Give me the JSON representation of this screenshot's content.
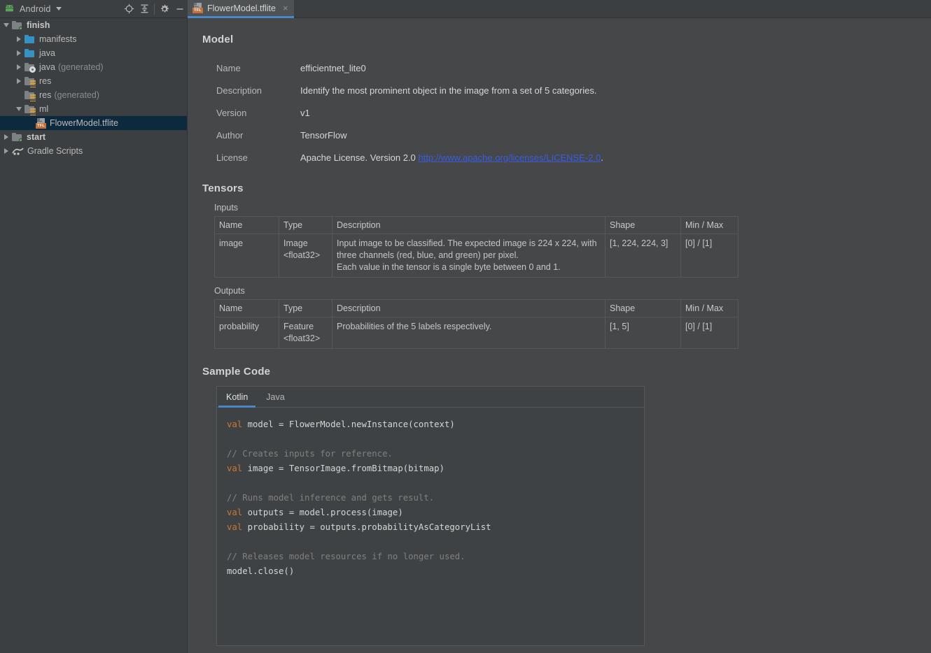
{
  "toolbar": {
    "app_label": "Android",
    "dropdown_icon": "caret-down-icon",
    "buttons": [
      {
        "name": "locate-icon",
        "title": "Select Opened File"
      },
      {
        "name": "collapse-all-icon",
        "title": "Collapse All"
      },
      {
        "name": "gear-icon",
        "title": "Settings"
      },
      {
        "name": "minimize-icon",
        "title": "Hide"
      }
    ]
  },
  "tab": {
    "title": "FlowerModel.tflite",
    "icon": "tfl-file-icon",
    "badge": "TFL",
    "close_glyph": "×",
    "accent": "#4a88c7"
  },
  "tree": [
    {
      "label": "finish",
      "suffix": "",
      "indent": 0,
      "twisty": "down",
      "icon": "module-folder-icon",
      "bold": true,
      "selected": false
    },
    {
      "label": "manifests",
      "suffix": "",
      "indent": 1,
      "twisty": "right",
      "icon": "folder-icon",
      "bold": false,
      "selected": false
    },
    {
      "label": "java",
      "suffix": "",
      "indent": 1,
      "twisty": "right",
      "icon": "folder-icon",
      "bold": false,
      "selected": false
    },
    {
      "label": "java",
      "suffix": " (generated)",
      "indent": 1,
      "twisty": "right",
      "icon": "generated-folder-icon",
      "bold": false,
      "selected": false
    },
    {
      "label": "res",
      "suffix": "",
      "indent": 1,
      "twisty": "right",
      "icon": "res-folder-icon",
      "bold": false,
      "selected": false
    },
    {
      "label": "res",
      "suffix": " (generated)",
      "indent": 1,
      "twisty": "none",
      "icon": "res-folder-icon",
      "bold": false,
      "selected": false
    },
    {
      "label": "ml",
      "suffix": "",
      "indent": 1,
      "twisty": "down",
      "icon": "res-folder-icon",
      "bold": false,
      "selected": false
    },
    {
      "label": "FlowerModel.tflite",
      "suffix": "",
      "indent": 2,
      "twisty": "none",
      "icon": "tfl-file-icon",
      "bold": false,
      "selected": true
    },
    {
      "label": "start",
      "suffix": "",
      "indent": 0,
      "twisty": "right",
      "icon": "module-folder-icon",
      "bold": true,
      "selected": false
    },
    {
      "label": "Gradle Scripts",
      "suffix": "",
      "indent": 0,
      "twisty": "right",
      "icon": "gradle-icon",
      "bold": false,
      "selected": false
    }
  ],
  "model": {
    "heading": "Model",
    "rows": [
      {
        "key": "Name",
        "value": "efficientnet_lite0"
      },
      {
        "key": "Description",
        "value": "Identify the most prominent object in the image from a set of 5 categories."
      },
      {
        "key": "Version",
        "value": "v1"
      },
      {
        "key": "Author",
        "value": "TensorFlow"
      }
    ],
    "license": {
      "key": "License",
      "prefix": "Apache License. Version 2.0 ",
      "link_text": "http://www.apache.org/licenses/LICENSE-2.0",
      "suffix": ".",
      "link_color": "#3b5ce0"
    }
  },
  "tensors": {
    "heading": "Tensors",
    "columns": [
      "Name",
      "Type",
      "Description",
      "Shape",
      "Min / Max"
    ],
    "inputs": {
      "label": "Inputs",
      "rows": [
        {
          "name": "image",
          "type": "Image\n<float32>",
          "description": "Input image to be classified. The expected image is 224 x 224, with three channels (red, blue, and green) per pixel.\nEach value in the tensor is a single byte between 0 and 1.",
          "shape": "[1, 224, 224, 3]",
          "minmax": "[0] / [1]"
        }
      ]
    },
    "outputs": {
      "label": "Outputs",
      "rows": [
        {
          "name": "probability",
          "type": "Feature\n<float32>",
          "description": "Probabilities of the 5 labels respectively.",
          "shape": "[1, 5]",
          "minmax": "[0] / [1]"
        }
      ]
    }
  },
  "sample_code": {
    "heading": "Sample Code",
    "tabs": [
      {
        "label": "Kotlin",
        "active": true
      },
      {
        "label": "Java",
        "active": false
      }
    ],
    "code_kotlin": "val model = FlowerModel.newInstance(context)\n\n// Creates inputs for reference.\nval image = TensorImage.fromBitmap(bitmap)\n\n// Runs model inference and gets result.\nval outputs = model.process(image)\nval probability = outputs.probabilityAsCategoryList\n\n// Releases model resources if no longer used.\nmodel.close()",
    "syntax": {
      "keyword_color": "#cc7832",
      "comment_color": "#808080",
      "text_color": "#d6d6d6"
    }
  },
  "theme": {
    "window_bg": "#454749",
    "panel_bg": "#3c3f41",
    "selection_bg": "#0d293e",
    "accent": "#4a88c7",
    "text": "#bbbbbb"
  }
}
